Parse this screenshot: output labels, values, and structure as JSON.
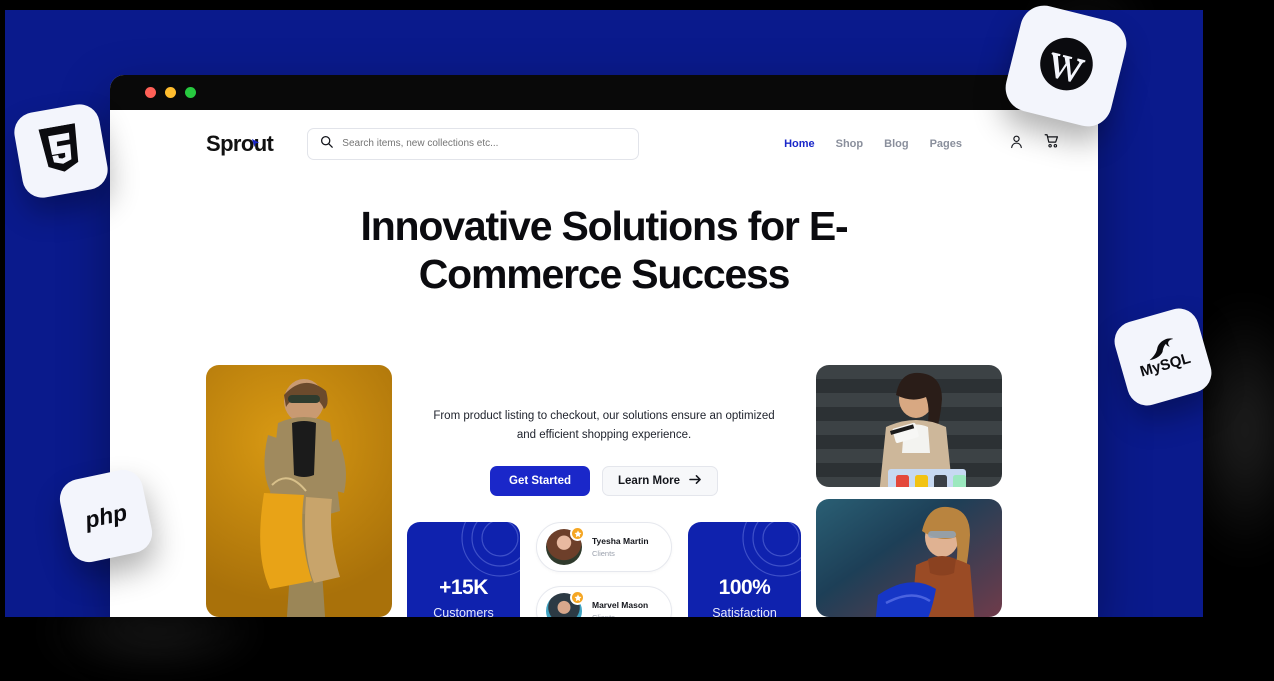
{
  "window": {
    "traffic_lights": [
      {
        "name": "close",
        "color": "#FF6057"
      },
      {
        "name": "minimize",
        "color": "#FFBD2E"
      },
      {
        "name": "maximize",
        "color": "#27C93F"
      }
    ]
  },
  "theme": {
    "stage_blue": "#0A1A8C",
    "accent_blue": "#1A27C9",
    "card_blue": "#0F22AE",
    "star_orange": "#F5A623",
    "titlebar": "#090909"
  },
  "site": {
    "brand": "Sprout",
    "search": {
      "placeholder": "Search items, new collections etc...",
      "value": "",
      "icon": "search-icon"
    },
    "nav": [
      {
        "label": "Home",
        "active": true
      },
      {
        "label": "Shop",
        "active": false
      },
      {
        "label": "Blog",
        "active": false
      },
      {
        "label": "Pages",
        "active": false
      }
    ],
    "header_icons": [
      {
        "name": "user-account-icon"
      },
      {
        "name": "shopping-cart-icon"
      }
    ]
  },
  "hero": {
    "title": "Innovative Solutions for E-Commerce Success",
    "subtitle": "From product listing to checkout, our solutions ensure an optimized and efficient shopping experience.",
    "cta_primary": "Get Started",
    "cta_secondary": "Learn More",
    "cta_secondary_icon": "arrow-right-icon"
  },
  "stats": [
    {
      "value": "+15K",
      "label": "Customers"
    },
    {
      "value": "100%",
      "label": "Satisfaction"
    }
  ],
  "testimonials": [
    {
      "name": "Tyesha Martin",
      "role": "Clients",
      "badge": "star-icon"
    },
    {
      "name": "Marvel Mason",
      "role": "Clients",
      "badge": "star-icon"
    }
  ],
  "photos": [
    {
      "name": "photo-woman-shopping-bags",
      "alt": "Woman in checkered suit holding yellow shopping bags on gold background"
    },
    {
      "name": "photo-woman-credit-card",
      "alt": "Woman holding credit card and shopping bag with sale tags"
    },
    {
      "name": "photo-woman-blue-coat",
      "alt": "Woman in brown turtleneck holding blue coat"
    }
  ],
  "tech_badges": [
    {
      "name": "wordpress-logo",
      "label": "W"
    },
    {
      "name": "html5-logo",
      "label": "5"
    },
    {
      "name": "mysql-logo",
      "label": "MySQL"
    },
    {
      "name": "php-logo",
      "label": "php"
    }
  ]
}
